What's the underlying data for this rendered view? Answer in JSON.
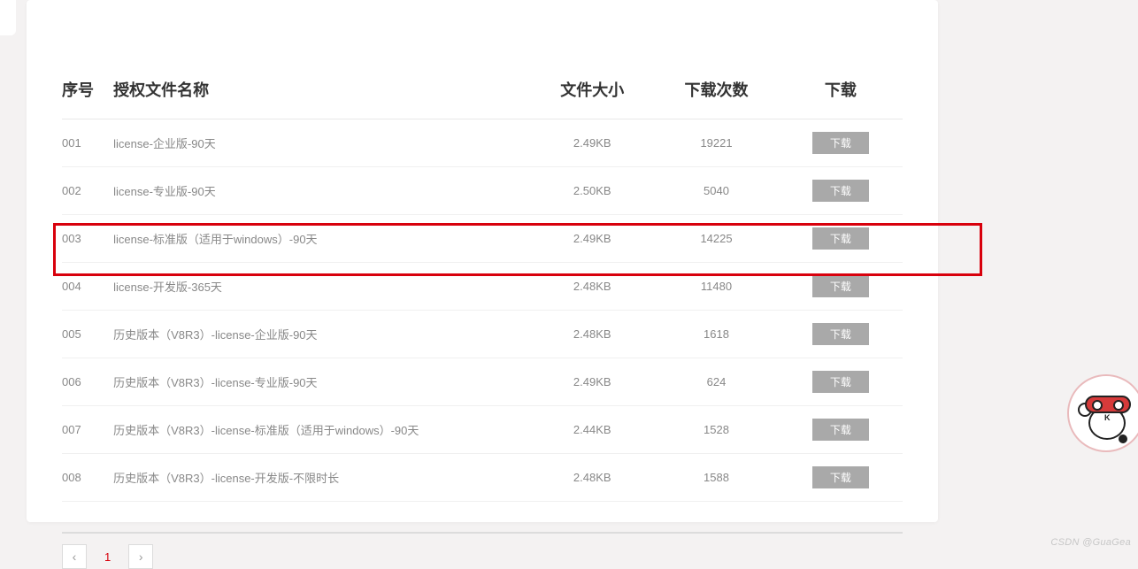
{
  "headers": {
    "index": "序号",
    "name": "授权文件名称",
    "size": "文件大小",
    "count": "下载次数",
    "download": "下载"
  },
  "download_label": "下载",
  "rows": [
    {
      "idx": "001",
      "name": "license-企业版-90天",
      "size": "2.49KB",
      "count": "19221"
    },
    {
      "idx": "002",
      "name": "license-专业版-90天",
      "size": "2.50KB",
      "count": "5040"
    },
    {
      "idx": "003",
      "name": "license-标准版（适用于windows）-90天",
      "size": "2.49KB",
      "count": "14225"
    },
    {
      "idx": "004",
      "name": "license-开发版-365天",
      "size": "2.48KB",
      "count": "11480"
    },
    {
      "idx": "005",
      "name": "历史版本（V8R3）-license-企业版-90天",
      "size": "2.48KB",
      "count": "1618"
    },
    {
      "idx": "006",
      "name": "历史版本（V8R3）-license-专业版-90天",
      "size": "2.49KB",
      "count": "624"
    },
    {
      "idx": "007",
      "name": "历史版本（V8R3）-license-标准版（适用于windows）-90天",
      "size": "2.44KB",
      "count": "1528"
    },
    {
      "idx": "008",
      "name": "历史版本（V8R3）-license-开发版-不限时长",
      "size": "2.48KB",
      "count": "1588"
    }
  ],
  "highlighted_row_index": 3,
  "pagination": {
    "current_page": "1",
    "prev_glyph": "‹",
    "next_glyph": "›"
  },
  "watermark": "CSDN @GuaGea"
}
